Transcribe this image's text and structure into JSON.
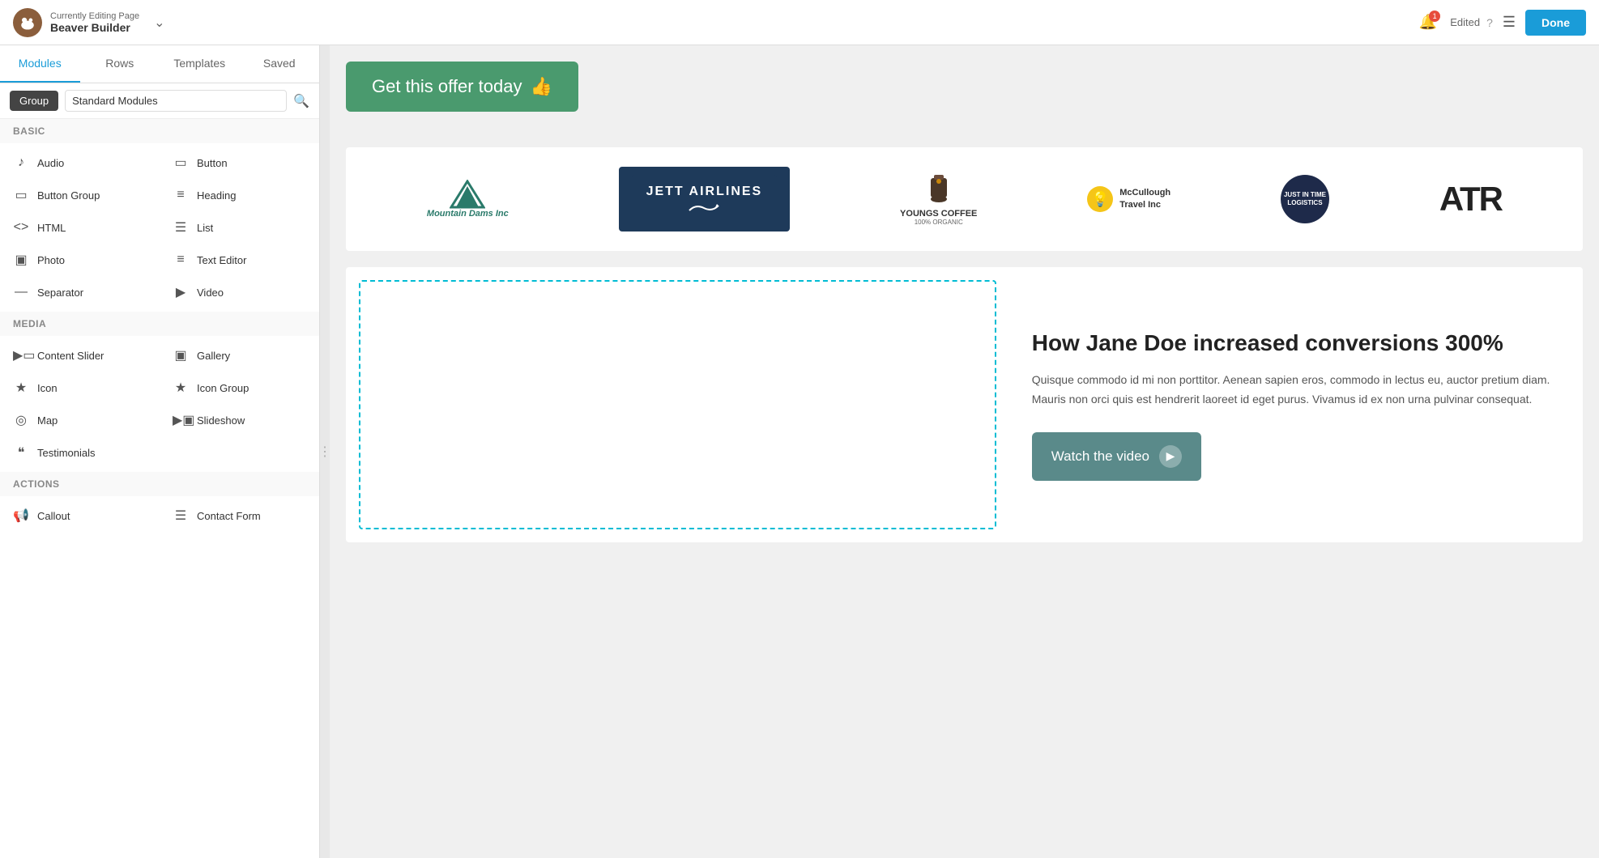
{
  "header": {
    "currently_editing_label": "Currently Editing Page",
    "app_name": "Beaver Builder",
    "edited_label": "Edited",
    "done_label": "Done",
    "bell_badge": "1"
  },
  "tabs": [
    {
      "label": "Modules",
      "active": true
    },
    {
      "label": "Rows",
      "active": false
    },
    {
      "label": "Templates",
      "active": false
    },
    {
      "label": "Saved",
      "active": false
    }
  ],
  "filter": {
    "group_label": "Group",
    "standard_modules_label": "Standard Modules"
  },
  "sections": [
    {
      "name": "Basic",
      "modules": [
        {
          "label": "Audio",
          "icon": "♪"
        },
        {
          "label": "Button",
          "icon": "▭"
        },
        {
          "label": "Button Group",
          "icon": "▭▭"
        },
        {
          "label": "Heading",
          "icon": "≡"
        },
        {
          "label": "HTML",
          "icon": "<>"
        },
        {
          "label": "List",
          "icon": "☰"
        },
        {
          "label": "Photo",
          "icon": "▣"
        },
        {
          "label": "Text Editor",
          "icon": "≡"
        },
        {
          "label": "Separator",
          "icon": "—"
        },
        {
          "label": "Video",
          "icon": "▶"
        }
      ]
    },
    {
      "name": "Media",
      "modules": [
        {
          "label": "Content Slider",
          "icon": "▶▶"
        },
        {
          "label": "Gallery",
          "icon": "▣▣"
        },
        {
          "label": "Icon",
          "icon": "★"
        },
        {
          "label": "Icon Group",
          "icon": "★★"
        },
        {
          "label": "Map",
          "icon": "◎"
        },
        {
          "label": "Slideshow",
          "icon": "▶▣"
        },
        {
          "label": "Testimonials",
          "icon": "❝"
        }
      ]
    },
    {
      "name": "Actions",
      "modules": [
        {
          "label": "Callout",
          "icon": "📢"
        },
        {
          "label": "Contact Form",
          "icon": "☰"
        }
      ]
    }
  ],
  "canvas": {
    "offer_button_label": "Get this offer today",
    "heading": "How Jane Doe increased conversions 300%",
    "body_text": "Quisque commodo id mi non porttitor. Aenean sapien eros, commodo in lectus eu, auctor pretium diam. Mauris non orci quis est hendrerit laoreet id eget purus. Vivamus id ex non urna pulvinar consequat.",
    "watch_button_label": "Watch the video",
    "logos": [
      {
        "name": "Mountain Dams Inc"
      },
      {
        "name": "Jett Airlines"
      },
      {
        "name": "Youngs Coffee"
      },
      {
        "name": "McCullough Travel Inc"
      },
      {
        "name": "Just In Time Logistics"
      },
      {
        "name": "ATR"
      }
    ]
  }
}
